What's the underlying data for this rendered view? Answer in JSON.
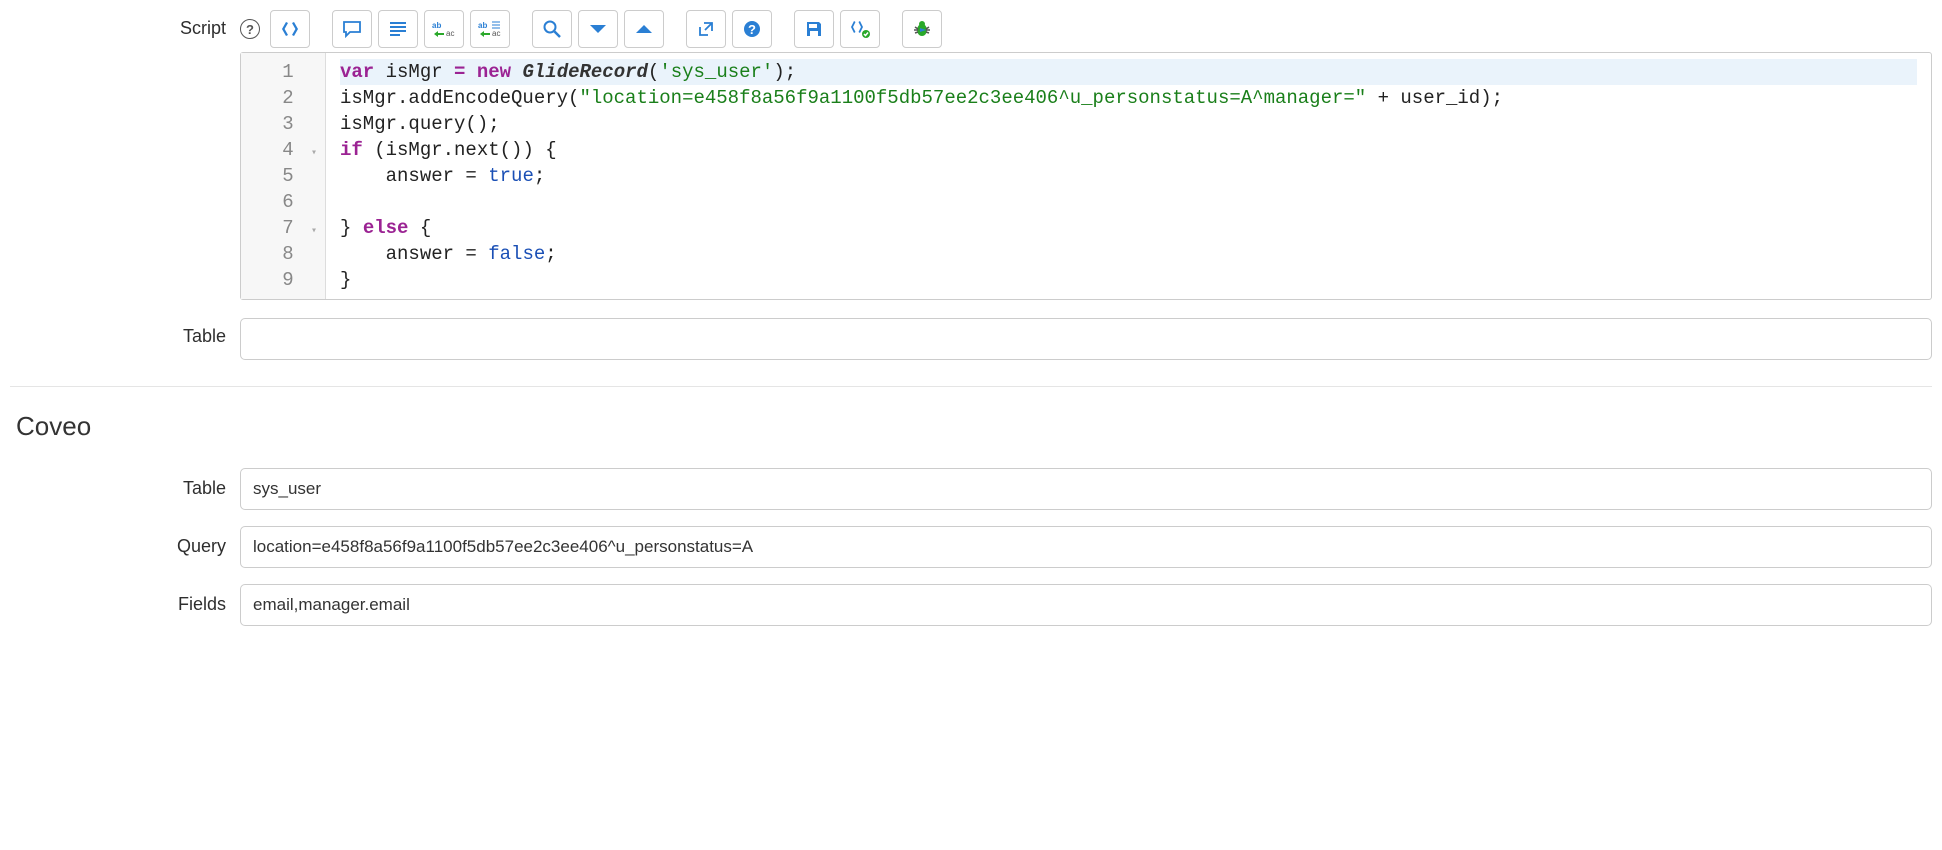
{
  "labels": {
    "script": "Script",
    "table_upper": "Table",
    "section": "Coveo",
    "table": "Table",
    "query": "Query",
    "fields": "Fields"
  },
  "toolbar": {
    "help": "help-icon",
    "format": "format-code-icon",
    "comment": "comment-icon",
    "lines": "lines-icon",
    "replace": "replace-icon",
    "replace_all": "replace-all-icon",
    "search": "search-icon",
    "find_next": "find-next-icon",
    "find_prev": "find-prev-icon",
    "popout": "popout-icon",
    "help_doc": "help-doc-icon",
    "save": "save-icon",
    "syntax": "syntax-check-icon",
    "debug": "debug-icon"
  },
  "code": {
    "lines": [
      {
        "n": "1",
        "fold": "",
        "tokens": [
          {
            "c": "tok-kw",
            "t": "var"
          },
          {
            "c": "tok-pl",
            "t": " isMgr "
          },
          {
            "c": "tok-kw",
            "t": "="
          },
          {
            "c": "tok-pl",
            "t": " "
          },
          {
            "c": "tok-kw",
            "t": "new"
          },
          {
            "c": "tok-pl",
            "t": " "
          },
          {
            "c": "tok-cls",
            "t": "GlideRecord"
          },
          {
            "c": "tok-pl",
            "t": "("
          },
          {
            "c": "tok-str",
            "t": "'sys_user'"
          },
          {
            "c": "tok-pl",
            "t": ");"
          }
        ],
        "active": true
      },
      {
        "n": "2",
        "fold": "",
        "tokens": [
          {
            "c": "tok-pl",
            "t": "isMgr.addEncodeQuery("
          },
          {
            "c": "tok-str",
            "t": "\"location=e458f8a56f9a1100f5db57ee2c3ee406^u_personstatus=A^manager=\""
          },
          {
            "c": "tok-pl",
            "t": " + user_id);"
          }
        ]
      },
      {
        "n": "3",
        "fold": "",
        "tokens": [
          {
            "c": "tok-pl",
            "t": "isMgr.query();"
          }
        ]
      },
      {
        "n": "4",
        "fold": "▾",
        "tokens": [
          {
            "c": "tok-kw",
            "t": "if"
          },
          {
            "c": "tok-pl",
            "t": " (isMgr.next()) {"
          }
        ]
      },
      {
        "n": "5",
        "fold": "",
        "tokens": [
          {
            "c": "tok-pl",
            "t": "    answer = "
          },
          {
            "c": "tok-lit",
            "t": "true"
          },
          {
            "c": "tok-pl",
            "t": ";"
          }
        ]
      },
      {
        "n": "6",
        "fold": "",
        "tokens": [
          {
            "c": "tok-pl",
            "t": ""
          }
        ]
      },
      {
        "n": "7",
        "fold": "▾",
        "tokens": [
          {
            "c": "tok-pl",
            "t": "} "
          },
          {
            "c": "tok-kw",
            "t": "else"
          },
          {
            "c": "tok-pl",
            "t": " {"
          }
        ]
      },
      {
        "n": "8",
        "fold": "",
        "tokens": [
          {
            "c": "tok-pl",
            "t": "    answer = "
          },
          {
            "c": "tok-lit",
            "t": "false"
          },
          {
            "c": "tok-pl",
            "t": ";"
          }
        ]
      },
      {
        "n": "9",
        "fold": "",
        "tokens": [
          {
            "c": "tok-pl",
            "t": "}"
          }
        ]
      }
    ]
  },
  "fields": {
    "table_upper": "",
    "table": "sys_user",
    "query": "location=e458f8a56f9a1100f5db57ee2c3ee406^u_personstatus=A",
    "fields": "email,manager.email"
  }
}
